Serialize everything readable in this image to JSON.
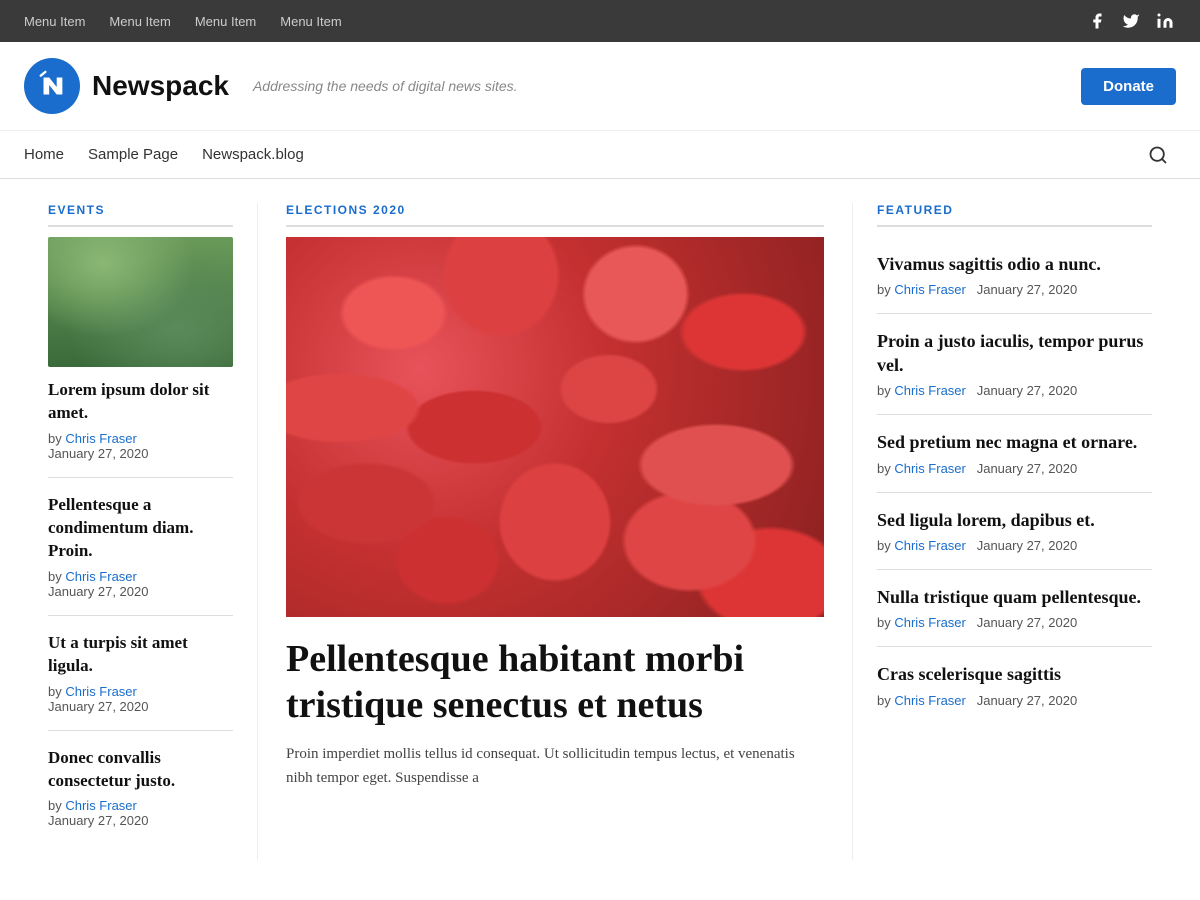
{
  "topbar": {
    "menu_items": [
      "Menu Item",
      "Menu Item",
      "Menu Item",
      "Menu Item"
    ],
    "social": [
      "f",
      "t",
      "in"
    ]
  },
  "header": {
    "logo_alt": "Newspack logo",
    "site_name": "Newspack",
    "tagline": "Addressing the needs of digital news sites.",
    "donate_label": "Donate"
  },
  "nav": {
    "links": [
      "Home",
      "Sample Page",
      "Newspack.blog"
    ],
    "search_aria": "Search"
  },
  "left_column": {
    "section_label": "EVENTS",
    "articles": [
      {
        "title": "Lorem ipsum dolor sit amet.",
        "by": "by",
        "author": "Chris Fraser",
        "date": "January 27, 2020",
        "has_image": true
      },
      {
        "title": "Pellentesque a condimentum diam. Proin.",
        "by": "by",
        "author": "Chris Fraser",
        "date": "January 27, 2020",
        "has_image": false
      },
      {
        "title": "Ut a turpis sit amet ligula.",
        "by": "by",
        "author": "Chris Fraser",
        "date": "January 27, 2020",
        "has_image": false
      },
      {
        "title": "Donec convallis consectetur justo.",
        "by": "by",
        "author": "Chris Fraser",
        "date": "January 27, 2020",
        "has_image": false
      }
    ]
  },
  "middle_column": {
    "section_label": "ELECTIONS 2020",
    "headline": "Pellentesque habitant morbi tristique senectus et netus",
    "excerpt": "Proin imperdiet mollis tellus id consequat. Ut sollicitudin tempus lectus, et venenatis nibh tempor eget. Suspendisse a"
  },
  "right_column": {
    "section_label": "FEATURED",
    "articles": [
      {
        "title": "Vivamus sagittis odio a nunc.",
        "by": "by",
        "author": "Chris Fraser",
        "date": "January 27, 2020"
      },
      {
        "title": "Proin a justo iaculis, tempor purus vel.",
        "by": "by",
        "author": "Chris Fraser",
        "date": "January 27, 2020"
      },
      {
        "title": "Sed pretium nec magna et ornare.",
        "by": "by",
        "author": "Chris Fraser",
        "date": "January 27, 2020"
      },
      {
        "title": "Sed ligula lorem, dapibus et.",
        "by": "by",
        "author": "Chris Fraser",
        "date": "January 27, 2020"
      },
      {
        "title": "Nulla tristique quam pellentesque.",
        "by": "by",
        "author": "Chris Fraser",
        "date": "January 27, 2020"
      },
      {
        "title": "Cras scelerisque sagittis",
        "by": "by",
        "author": "Chris Fraser",
        "date": "January 27, 2020"
      }
    ]
  },
  "colors": {
    "accent": "#1a6dcc",
    "text_dark": "#111",
    "text_muted": "#555",
    "border": "#ddd"
  }
}
